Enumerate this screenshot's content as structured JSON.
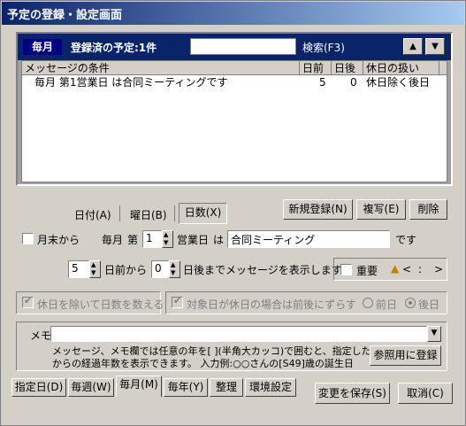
{
  "window": {
    "title": "予定の登録・設定画面"
  },
  "panel": {
    "period_label": "毎月",
    "registered": "登録済の予定:1件",
    "search_value": "",
    "search_label": "検索(F3)",
    "nav_up": "▲",
    "nav_down": "▼",
    "columns": {
      "condition": "メッセージの条件",
      "before": "日前",
      "after": "日後",
      "holiday": "休日の扱い"
    },
    "rows": [
      {
        "condition": "毎月 第1営業日 は合同ミーティングです",
        "before": "5",
        "after": "0",
        "holiday": "休日除く後日"
      }
    ]
  },
  "mode_tabs": {
    "date": "日付(A)",
    "weekday": "曜日(B)",
    "days": "日数(X)"
  },
  "actions": {
    "new": "新規登録(N)",
    "copy": "複写(E)",
    "delete": "削除"
  },
  "schedule": {
    "month_end_label": "月末から",
    "every_month": "毎月",
    "nth": "第",
    "nth_value": "1",
    "business_day": "営業日",
    "wa": "は",
    "message": "合同ミーティング",
    "desu": "です"
  },
  "display": {
    "before_value": "5",
    "before_label": "日前から",
    "after_value": "0",
    "after_label": "日後までメッセージを表示します"
  },
  "importance": {
    "label": "重要",
    "left": "<",
    "colon": ":",
    "right": ">"
  },
  "options": {
    "exclude_holidays": "休日を除いて日数を数える",
    "shift_if_holiday": "対象日が休日の場合は前後にずらす",
    "before": "前日",
    "after": "後日"
  },
  "memo": {
    "label": "メモ",
    "value": "",
    "help1": "メッセージ、メモ欄では任意の年を[ ](半角大カッコ)で囲むと、指定した年",
    "help2": "からの経過年数を表示できます。  入力例:○○さんの[S49]歳の誕生日",
    "register_button": "参照用に登録"
  },
  "bottom_tabs": [
    "指定日(D)",
    "毎週(W)",
    "毎月(M)",
    "毎年(Y)",
    "整理",
    "環境設定"
  ],
  "footer": {
    "save": "変更を保存(S)",
    "cancel": "取消(C)"
  }
}
